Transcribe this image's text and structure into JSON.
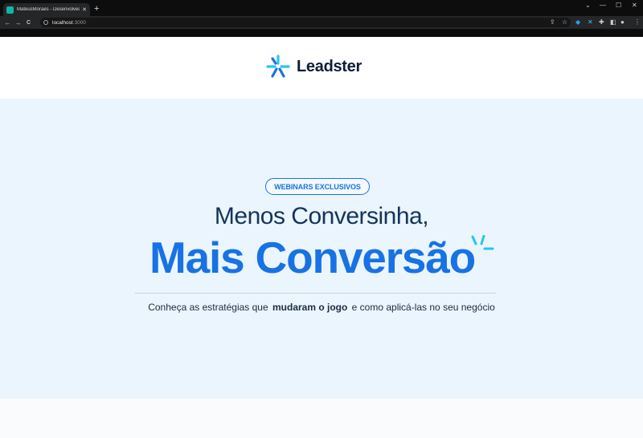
{
  "browser": {
    "tab_title": "MateusMoraes - Desenvolvedor",
    "tab_close": "✕",
    "new_tab": "+",
    "url_host": "localhost",
    "url_port": ":3000",
    "nav": {
      "back": "←",
      "forward": "→",
      "reload": "C"
    },
    "window_controls": {
      "chevron": "⌄",
      "minimize": "—",
      "maximize": "☐",
      "close": "✕"
    }
  },
  "header": {
    "logo_text": "Leadster"
  },
  "hero": {
    "badge": "WEBINARS EXCLUSIVOS",
    "title": "Menos Conversinha,",
    "accent": "Mais Conversão",
    "subtitle_before": "Conheça as estratégias que",
    "subtitle_bold": "mudaram o jogo",
    "subtitle_after": "e como aplicá-las no seu negócio"
  },
  "colors": {
    "brand_blue": "#1872e3",
    "brand_cyan": "#25c5f0",
    "navy": "#13355b",
    "hero_bg": "#eaf5fd"
  }
}
